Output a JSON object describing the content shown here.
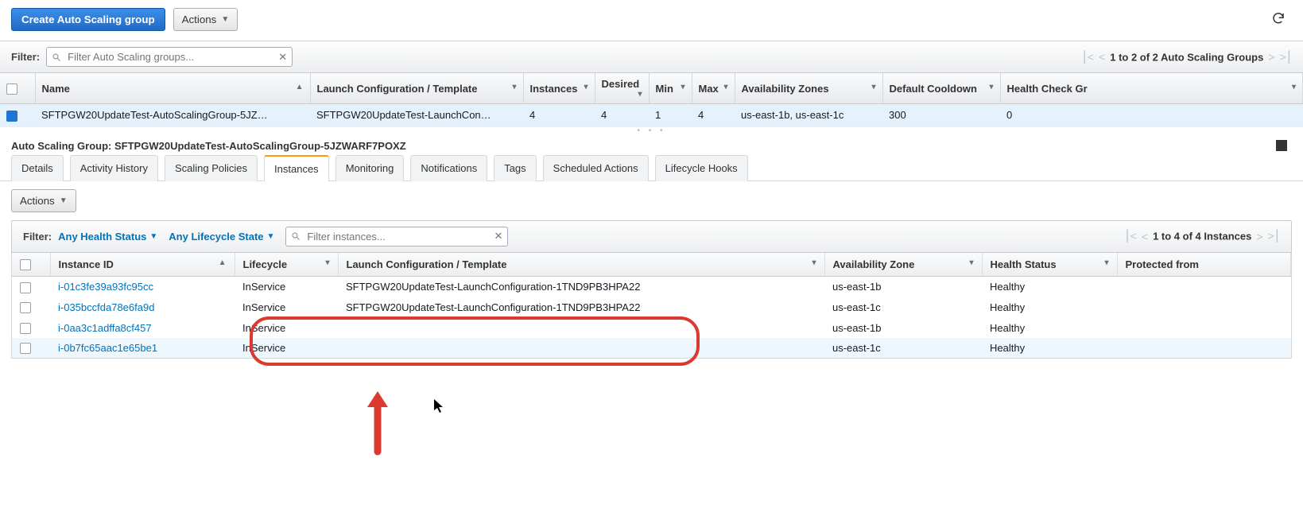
{
  "toolbar": {
    "create_label": "Create Auto Scaling group",
    "actions_label": "Actions"
  },
  "asg_table": {
    "filter_label": "Filter:",
    "filter_placeholder": "Filter Auto Scaling groups...",
    "pager_text": "1 to 2 of 2 Auto Scaling Groups",
    "columns": {
      "name": "Name",
      "launch": "Launch Configuration / Template",
      "instances": "Instances",
      "desired": "Desired",
      "min": "Min",
      "max": "Max",
      "az": "Availability Zones",
      "cooldown": "Default Cooldown",
      "health": "Health Check Gr"
    },
    "rows": [
      {
        "name": "SFTPGW20UpdateTest-AutoScalingGroup-5JZ…",
        "launch": "SFTPGW20UpdateTest-LaunchCon…",
        "instances": "4",
        "desired": "4",
        "min": "1",
        "max": "4",
        "az": "us-east-1b, us-east-1c",
        "cooldown": "300",
        "health": "0"
      }
    ]
  },
  "details": {
    "title_prefix": "Auto Scaling Group: ",
    "title_name": "SFTPGW20UpdateTest-AutoScalingGroup-5JZWARF7POXZ",
    "tabs": {
      "details": "Details",
      "activity": "Activity History",
      "scaling": "Scaling Policies",
      "instances": "Instances",
      "monitoring": "Monitoring",
      "notifications": "Notifications",
      "tags": "Tags",
      "scheduled": "Scheduled Actions",
      "lifecycle": "Lifecycle Hooks"
    },
    "actions_label": "Actions"
  },
  "instances_panel": {
    "filter_label": "Filter:",
    "health_filter": "Any Health Status",
    "lifecycle_filter": "Any Lifecycle State",
    "filter_placeholder": "Filter instances...",
    "pager_text": "1 to 4 of 4 Instances",
    "columns": {
      "id": "Instance ID",
      "lifecycle": "Lifecycle",
      "launch": "Launch Configuration / Template",
      "az": "Availability Zone",
      "health": "Health Status",
      "protected": "Protected from"
    },
    "rows": [
      {
        "id": "i-01c3fe39a93fc95cc",
        "lifecycle": "InService",
        "launch": "SFTPGW20UpdateTest-LaunchConfiguration-1TND9PB3HPA22",
        "az": "us-east-1b",
        "health": "Healthy",
        "protected": ""
      },
      {
        "id": "i-035bccfda78e6fa9d",
        "lifecycle": "InService",
        "launch": "SFTPGW20UpdateTest-LaunchConfiguration-1TND9PB3HPA22",
        "az": "us-east-1c",
        "health": "Healthy",
        "protected": ""
      },
      {
        "id": "i-0aa3c1adffa8cf457",
        "lifecycle": "InService",
        "launch": "",
        "az": "us-east-1b",
        "health": "Healthy",
        "protected": ""
      },
      {
        "id": "i-0b7fc65aac1e65be1",
        "lifecycle": "InService",
        "launch": "",
        "az": "us-east-1c",
        "health": "Healthy",
        "protected": ""
      }
    ]
  }
}
